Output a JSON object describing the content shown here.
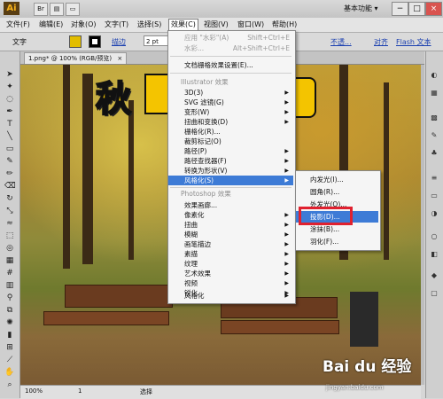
{
  "titlebar": {
    "app_logo": "Ai",
    "workspace": "基本功能 ▾",
    "minimize": "−",
    "maximize": "□",
    "close": "×"
  },
  "menubar": {
    "items": [
      "文件(F)",
      "编辑(E)",
      "对象(O)",
      "文字(T)",
      "选择(S)",
      "效果(C)",
      "视图(V)",
      "窗口(W)",
      "帮助(H)"
    ]
  },
  "control": {
    "mode_label": "文字",
    "stroke_link": "描边",
    "stroke_value": "2 pt",
    "opacity_link": "不透...",
    "align_link": "对齐",
    "flash_link": "Flash 文本"
  },
  "doc": {
    "tab_title": "1.png* @ 100% (RGB/预览)",
    "close": "×",
    "canvas_text": "秋"
  },
  "effects_menu": {
    "items": [
      {
        "label": "应用 \"水彩\"(A)",
        "shortcut": "Shift+Ctrl+E",
        "state": "disabled"
      },
      {
        "label": "水彩...",
        "shortcut": "Alt+Shift+Ctrl+E",
        "state": "disabled"
      },
      {
        "label": "文档栅格效果设置(E)...",
        "shortcut": "",
        "state": "normal"
      },
      {
        "label": "Illustrator 效果",
        "shortcut": "",
        "state": "header"
      },
      {
        "label": "3D(3)",
        "shortcut": "",
        "state": "submenu"
      },
      {
        "label": "SVG 滤镜(G)",
        "shortcut": "",
        "state": "submenu"
      },
      {
        "label": "变形(W)",
        "shortcut": "",
        "state": "submenu"
      },
      {
        "label": "扭曲和变换(D)",
        "shortcut": "",
        "state": "submenu"
      },
      {
        "label": "栅格化(R)...",
        "shortcut": "",
        "state": "normal"
      },
      {
        "label": "裁剪标记(O)",
        "shortcut": "",
        "state": "normal"
      },
      {
        "label": "路径(P)",
        "shortcut": "",
        "state": "submenu"
      },
      {
        "label": "路径查找器(F)",
        "shortcut": "",
        "state": "submenu"
      },
      {
        "label": "转换为形状(V)",
        "shortcut": "",
        "state": "submenu"
      },
      {
        "label": "风格化(S)",
        "shortcut": "",
        "state": "highlighted"
      },
      {
        "label": "Photoshop 效果",
        "shortcut": "",
        "state": "header"
      },
      {
        "label": "效果画廊...",
        "shortcut": "",
        "state": "normal"
      },
      {
        "label": "像素化",
        "shortcut": "",
        "state": "submenu"
      },
      {
        "label": "扭曲",
        "shortcut": "",
        "state": "submenu"
      },
      {
        "label": "模糊",
        "shortcut": "",
        "state": "submenu"
      },
      {
        "label": "画笔描边",
        "shortcut": "",
        "state": "submenu"
      },
      {
        "label": "素描",
        "shortcut": "",
        "state": "submenu"
      },
      {
        "label": "纹理",
        "shortcut": "",
        "state": "submenu"
      },
      {
        "label": "艺术效果",
        "shortcut": "",
        "state": "submenu"
      },
      {
        "label": "视频",
        "shortcut": "",
        "state": "submenu"
      },
      {
        "label": "锐化",
        "shortcut": "",
        "state": "submenu"
      },
      {
        "label": "风格化",
        "shortcut": "",
        "state": "submenu"
      }
    ]
  },
  "stylize_submenu": {
    "items": [
      "内发光(I)...",
      "圆角(R)...",
      "外发光(O)...",
      "投影(D)...",
      "涂抹(B)...",
      "羽化(F)..."
    ],
    "highlighted_index": 3
  },
  "status": {
    "zoom": "100%",
    "page": "1",
    "tool_state": "选择"
  },
  "watermark": {
    "brand": "Bai du 经验",
    "url": "jingyan.baidu.com"
  }
}
